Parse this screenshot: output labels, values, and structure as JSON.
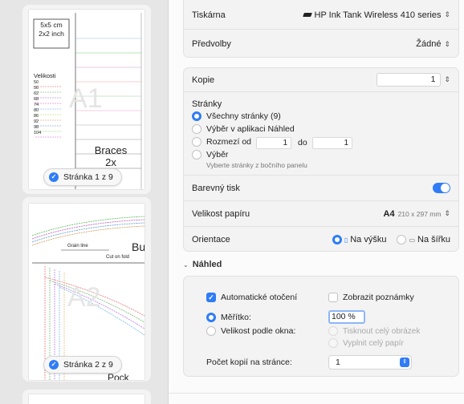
{
  "thumbnails": [
    {
      "size_box": [
        "5x5 cm",
        "2x2 inch"
      ],
      "sizes_title": "Velikosti",
      "sizes": [
        "50",
        "56",
        "62",
        "68",
        "74",
        "80",
        "86",
        "92",
        "98",
        "104"
      ],
      "watermark": "A1",
      "piece_title": "Braces",
      "piece_count": "2x",
      "badge": "Stránka 1 z 9"
    },
    {
      "grain_label": "Grain line",
      "fold_label": "Cut on fold",
      "piece_title": "Bu",
      "watermark": "A2",
      "bottom_text": "Pock",
      "badge": "Stránka 2 z 9"
    }
  ],
  "printer": {
    "label": "Tiskárna",
    "value": "HP Ink Tank Wireless 410 series"
  },
  "presets": {
    "label": "Předvolby",
    "value": "Žádné"
  },
  "copies": {
    "label": "Kopie",
    "value": "1"
  },
  "pages": {
    "label": "Stránky",
    "all": "Všechny stránky (9)",
    "selection_in_app": "Výběr v aplikaci Náhled",
    "range_label": "Rozmezí od",
    "range_from": "1",
    "range_to_label": "do",
    "range_to": "1",
    "selection": "Výběr",
    "selection_hint": "Vyberte stránky z bočního panelu"
  },
  "color_print": {
    "label": "Barevný tisk",
    "on": true
  },
  "paper_size": {
    "label": "Velikost papíru",
    "value": "A4",
    "detail": "210 x 297 mm"
  },
  "orientation": {
    "label": "Orientace",
    "portrait": "Na výšku",
    "landscape": "Na šířku"
  },
  "preview": {
    "section": "Náhled",
    "auto_rotate": "Automatické otočení",
    "show_notes": "Zobrazit poznámky",
    "scale_label": "Měřítko:",
    "scale_value": "100 %",
    "fit_label": "Velikost podle okna:",
    "print_whole": "Tisknout celý obrázek",
    "fill_paper": "Vyplnit celý papír",
    "copies_per_page_label": "Počet kopií na stránce:",
    "copies_per_page": "1"
  },
  "colors": {
    "accent": "#2f7cf6"
  }
}
